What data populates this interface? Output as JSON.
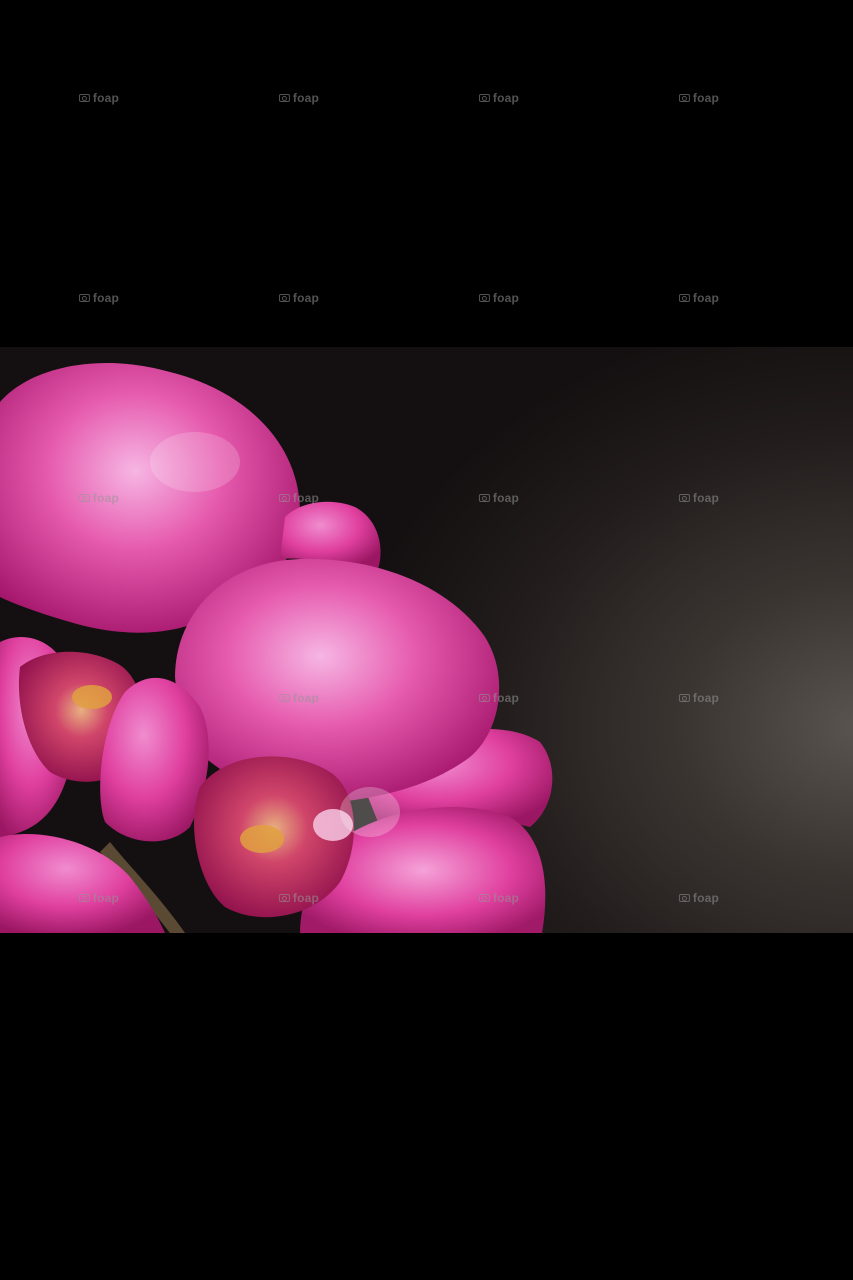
{
  "photo": {
    "subject": "pink orchid flowers against dark background",
    "colors": {
      "petal": "#e0409f",
      "petal_highlight": "#f4a9dc",
      "petal_shadow": "#9b1763",
      "lip": "#c21d5f",
      "background": "#2a2322",
      "frame": "#000000"
    }
  },
  "watermark": {
    "text": "foap",
    "icon": "camera-icon"
  }
}
